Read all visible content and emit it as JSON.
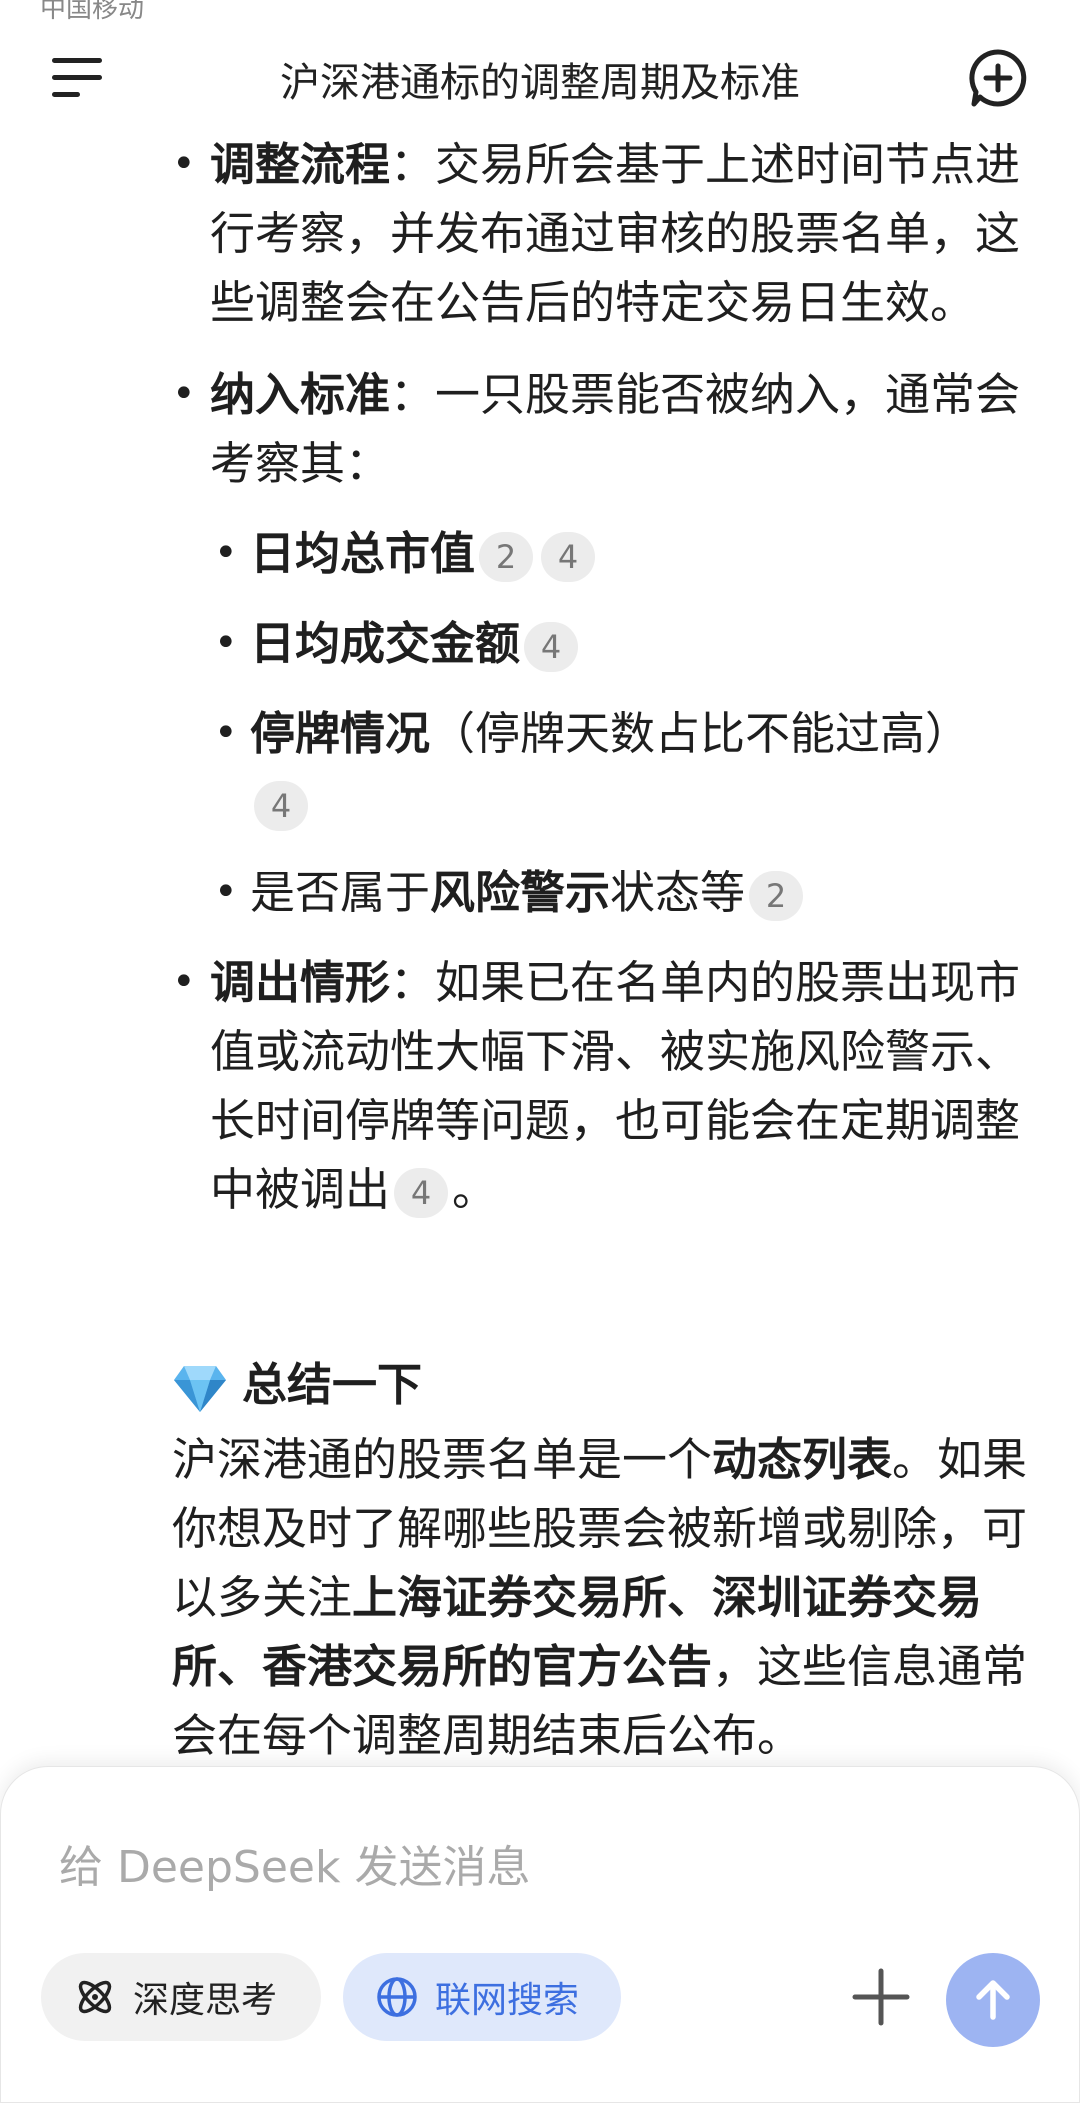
{
  "status_bar": {
    "carrier": "中国移动"
  },
  "header": {
    "title": "沪深港通标的调整周期及标准"
  },
  "content": {
    "process": {
      "label": "调整流程",
      "sep": "：",
      "text": "交易所会基于上述时间节点进行考察，并发布通过审核的股票名单，这些调整会在公告后的特定交易日生效。"
    },
    "criteria": {
      "label": "纳入标准",
      "sep": "：",
      "text": "一只股票能否被纳入，通常会考察其："
    },
    "criteria_items": {
      "market_cap": {
        "label": "日均总市值",
        "cites": [
          "2",
          "4"
        ]
      },
      "turnover": {
        "label": "日均成交金额",
        "cites": [
          "4"
        ]
      },
      "suspension": {
        "label": "停牌情况",
        "text": "（停牌天数占比不能过高）",
        "cites": [
          "4"
        ]
      },
      "risk": {
        "prefix": "是否属于",
        "label": "风险警示",
        "suffix": "状态等",
        "cites": [
          "2"
        ]
      }
    },
    "removal": {
      "label": "调出情形",
      "sep": "：",
      "text": "如果已在名单内的股票出现市值或流动性大幅下滑、被实施风险警示、长时间停牌等问题，也可能会在定期调整中被调出",
      "cite": "4",
      "end": "。"
    }
  },
  "summary": {
    "title": "总结一下",
    "part1": "沪深港通的股票名单是一个",
    "bold1": "动态列表",
    "part2": "。如果你想及时了解哪些股票会被新增或剔除，可以多关注",
    "bold2": "上海证券交易所、深圳证券交易所、香港交易所的官方公告",
    "part3": "，这些信息通常会在每个调整周期结束后公布。"
  },
  "composer": {
    "placeholder": "给 DeepSeek 发送消息",
    "deep_think_label": "深度思考",
    "web_search_label": "联网搜索"
  },
  "icons": {
    "menu": "menu-icon",
    "new_chat": "new-chat-icon",
    "deep_think": "atom-icon",
    "web_search": "globe-icon",
    "plus": "plus-icon",
    "send": "arrow-up-icon",
    "summary": "gem-icon"
  },
  "colors": {
    "accent": "#3d6fe0",
    "send_button": "#9db4f2",
    "web_chip_bg": "#dfe8fb",
    "cite_bg": "#ececec"
  }
}
